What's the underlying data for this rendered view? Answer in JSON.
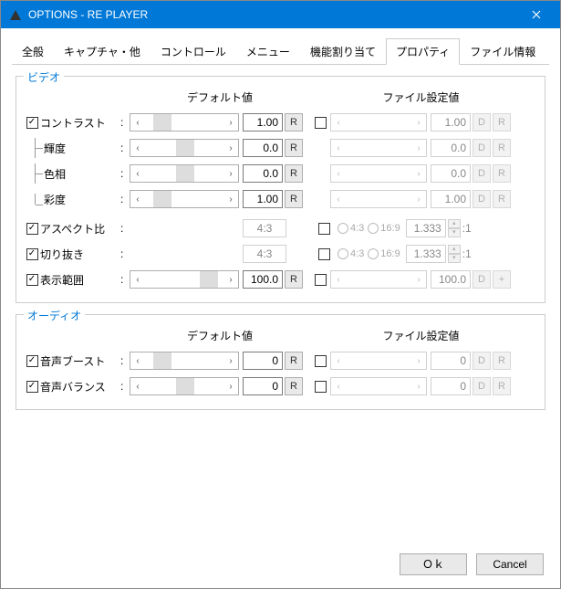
{
  "title": "OPTIONS - RE PLAYER",
  "tabs": [
    "全般",
    "キャプチャ・他",
    "コントロール",
    "メニュー",
    "機能割り当て",
    "プロパティ",
    "ファイル情報"
  ],
  "active_tab": 5,
  "headers": {
    "default": "デフォルト値",
    "file": "ファイル設定値"
  },
  "groups": {
    "video": "ビデオ",
    "audio": "オーディオ"
  },
  "btn": {
    "R": "R",
    "D": "D",
    "plus": "+"
  },
  "video_rows": {
    "contrast": {
      "label": "コントラスト",
      "checked": true,
      "dval": "1.00",
      "fval": "1.00",
      "thumb": 10
    },
    "brightness": {
      "label": "輝度",
      "checked": false,
      "dval": "0.0",
      "fval": "0.0",
      "thumb": 40,
      "indent": true
    },
    "hue": {
      "label": "色相",
      "checked": false,
      "dval": "0.0",
      "fval": "0.0",
      "thumb": 40,
      "indent": true
    },
    "saturation": {
      "label": "彩度",
      "checked": false,
      "dval": "1.00",
      "fval": "1.00",
      "thumb": 10,
      "indent": true
    },
    "aspect": {
      "label": "アスペクト比",
      "checked": true,
      "ratio": "4:3",
      "r1": "4:3",
      "r2": "16:9",
      "fval": "1.333",
      "suffix": ":1"
    },
    "crop": {
      "label": "切り抜き",
      "checked": true,
      "ratio": "4:3",
      "r1": "4:3",
      "r2": "16:9",
      "fval": "1.333",
      "suffix": ":1"
    },
    "range": {
      "label": "表示範囲",
      "checked": true,
      "dval": "100.0",
      "fval": "100.0",
      "thumb": 70,
      "extra": "+"
    }
  },
  "audio_rows": {
    "boost": {
      "label": "音声ブースト",
      "checked": true,
      "dval": "0",
      "fval": "0",
      "thumb": 10
    },
    "balance": {
      "label": "音声バランス",
      "checked": true,
      "dval": "0",
      "fval": "0",
      "thumb": 40
    }
  },
  "footer": {
    "ok": "Ｏｋ",
    "cancel": "Cancel"
  }
}
